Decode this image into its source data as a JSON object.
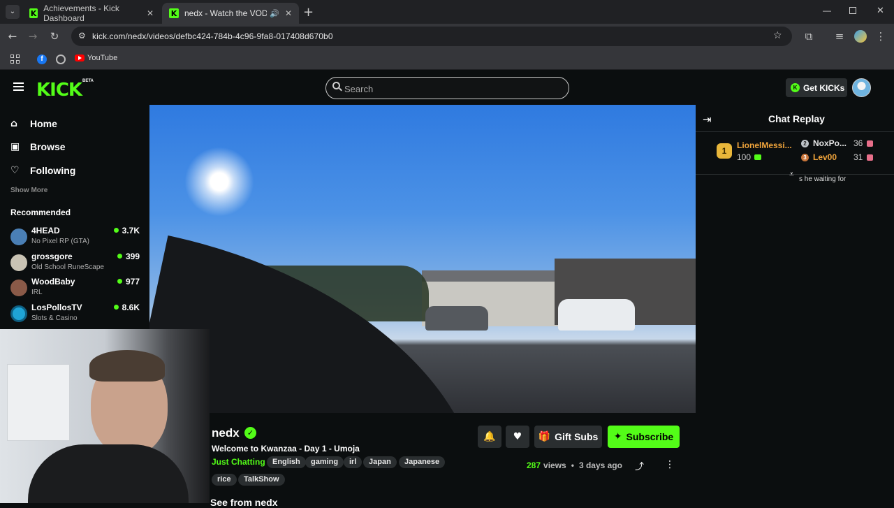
{
  "browser": {
    "tabs": [
      {
        "title": "Achievements - Kick Dashboard",
        "active": false
      },
      {
        "title": "nedx - Watch the VOD on Kick",
        "active": true
      }
    ],
    "url": "kick.com/nedx/videos/defbc424-784b-4c96-9fa8-017408d670b0",
    "bookmarks": [
      {
        "label": "YouTube"
      }
    ]
  },
  "header": {
    "logo": "KICK",
    "beta": "BETA",
    "search_placeholder": "Search",
    "get_kicks": "Get KICKs"
  },
  "sidebar": {
    "nav": [
      {
        "label": "Home",
        "icon": "home-icon"
      },
      {
        "label": "Browse",
        "icon": "browse-icon"
      },
      {
        "label": "Following",
        "icon": "heart-icon"
      }
    ],
    "show_more": "Show More",
    "recommended_title": "Recommended",
    "recommended": [
      {
        "name": "4HEAD",
        "category": "No Pixel RP (GTA)",
        "viewers": "3.7K",
        "color": "#4a7fb5"
      },
      {
        "name": "grossgore",
        "category": "Old School RuneScape",
        "viewers": "399",
        "color": "#c9c3b4"
      },
      {
        "name": "WoodBaby",
        "category": "IRL",
        "viewers": "977",
        "color": "#8a5a48"
      },
      {
        "name": "LosPollosTV",
        "category": "Slots & Casino",
        "viewers": "8.6K",
        "color": "#1fa4d6"
      }
    ]
  },
  "video": {
    "channel": "nedx",
    "title": "Welcome to Kwanzaa - Day 1 - Umoja",
    "category": "Just Chatting",
    "tags": [
      "English",
      "gaming",
      "irl",
      "Japan",
      "Japanese",
      "rice",
      "TalkShow"
    ],
    "views_count": "287",
    "views_label": "views",
    "posted": "3 days ago",
    "gift_subs": "Gift Subs",
    "subscribe": "Subscribe",
    "more_from": "See from nedx"
  },
  "chat": {
    "title": "Chat Replay",
    "leaders": [
      {
        "rank": "1",
        "name": "LionelMessi...",
        "amount": "100"
      },
      {
        "rank": "2",
        "name": "NoxPo...",
        "amount": "36"
      },
      {
        "rank": "3",
        "name": "Lev00",
        "amount": "31"
      }
    ],
    "message_fragment": "s he waiting for"
  }
}
